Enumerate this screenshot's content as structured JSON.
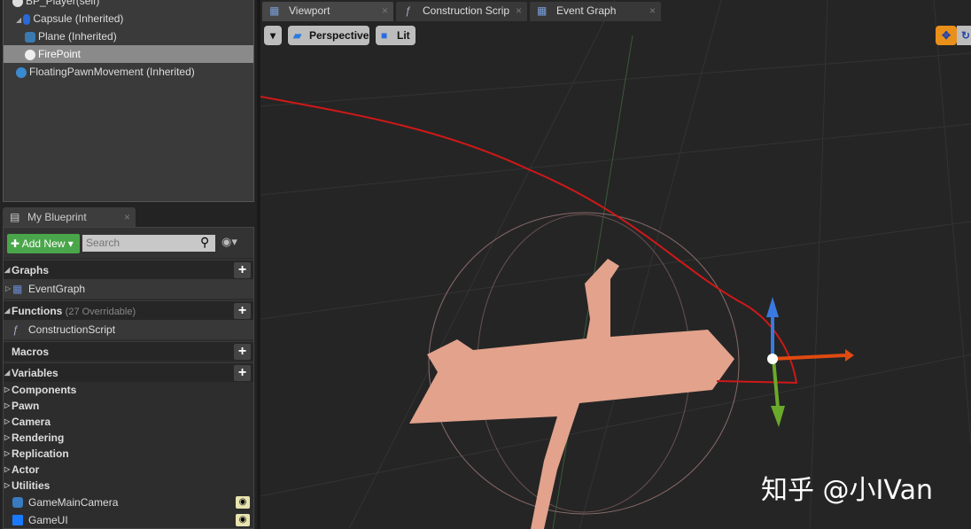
{
  "components": {
    "items": [
      {
        "label": "BP_Player(self)"
      },
      {
        "label": "Capsule (Inherited)"
      },
      {
        "label": "Plane (Inherited)"
      },
      {
        "label": "FirePoint"
      },
      {
        "label": "FloatingPawnMovement (Inherited)"
      }
    ]
  },
  "my_blueprint": {
    "tab_label": "My Blueprint",
    "add_new": "Add New",
    "search_placeholder": "Search",
    "graphs": {
      "title": "Graphs",
      "items": [
        "EventGraph"
      ]
    },
    "functions": {
      "title": "Functions",
      "note": "(27 Overridable)",
      "items": [
        "ConstructionScript"
      ]
    },
    "macros": {
      "title": "Macros"
    },
    "variables": {
      "title": "Variables",
      "categories": [
        "Components",
        "Pawn",
        "Camera",
        "Rendering",
        "Replication",
        "Actor",
        "Utilities"
      ],
      "items": [
        "GameMainCamera",
        "GameUI"
      ]
    }
  },
  "editor_tabs": [
    {
      "label": "Viewport"
    },
    {
      "label": "Construction Scrip"
    },
    {
      "label": "Event Graph"
    }
  ],
  "viewport": {
    "perspective": "Perspective",
    "lit": "Lit",
    "watermark": "知乎 @小IVan",
    "accent": "#e8901a"
  }
}
